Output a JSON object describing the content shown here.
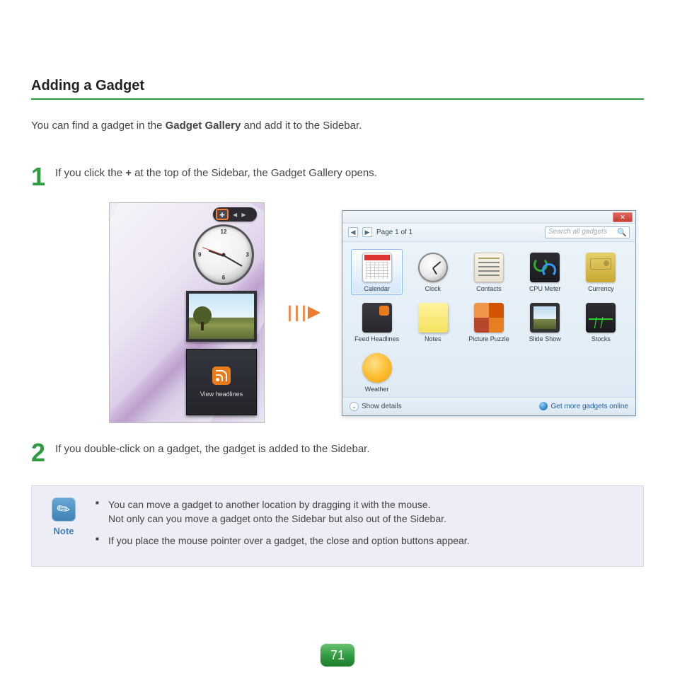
{
  "title": "Adding a Gadget",
  "intro": {
    "pre": "You can find a gadget in the ",
    "bold": "Gadget Gallery",
    "post": " and add it to the Sidebar."
  },
  "steps": {
    "1": {
      "num": "1",
      "pre": "If you click the ",
      "bold": "+",
      "post": " at the top of the Sidebar, the Gadget Gallery opens."
    },
    "2": {
      "num": "2",
      "text": "If you double-click on a gadget, the gadget is added to the Sidebar."
    }
  },
  "sidebar": {
    "plus": "+",
    "rss_label": "View headlines",
    "clock_numbers": {
      "n12": "12",
      "n3": "3",
      "n6": "6",
      "n9": "9"
    }
  },
  "gallery": {
    "close": "✕",
    "prev": "◀",
    "next": "▶",
    "page_label": "Page 1 of 1",
    "search_placeholder": "Search all gadgets",
    "search_icon": "🔍",
    "items": {
      "calendar": "Calendar",
      "clock": "Clock",
      "contacts": "Contacts",
      "cpu": "CPU Meter",
      "currency": "Currency",
      "feed": "Feed Headlines",
      "notes": "Notes",
      "puzzle": "Picture Puzzle",
      "slide": "Slide Show",
      "stocks": "Stocks",
      "weather": "Weather"
    },
    "show_details": "Show details",
    "more_online": "Get more gadgets online"
  },
  "note": {
    "label": "Note",
    "items": {
      "0": {
        "line1": "You can move a gadget to another location by dragging it with the mouse.",
        "line2": "Not only can you move a gadget onto the Sidebar but also out of the Sidebar."
      },
      "1": {
        "line1": "If you place the mouse pointer over a gadget, the close and option buttons appear."
      }
    }
  },
  "page_number": "71"
}
